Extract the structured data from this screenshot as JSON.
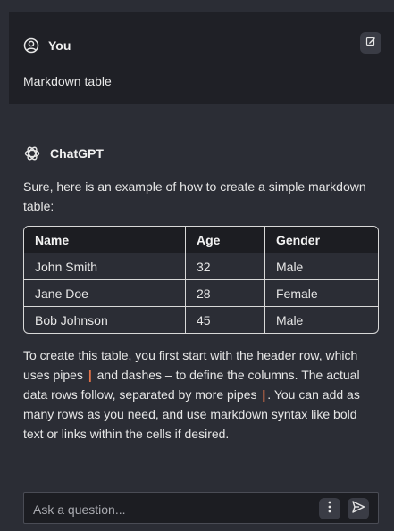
{
  "user_message": {
    "author": "You",
    "text": "Markdown table",
    "avatar_icon": "user-circle-icon",
    "edit_icon": "edit-icon"
  },
  "assistant_message": {
    "author": "ChatGPT",
    "avatar_icon": "openai-logo-icon",
    "intro": "Sure, here is an example of how to create a simple markdown table:",
    "table": {
      "headers": [
        "Name",
        "Age",
        "Gender"
      ],
      "rows": [
        [
          "John Smith",
          "32",
          "Male"
        ],
        [
          "Jane Doe",
          "28",
          "Female"
        ],
        [
          "Bob Johnson",
          "45",
          "Male"
        ]
      ]
    },
    "body": {
      "part1": "To create this table, you first start with the header row, which uses pipes",
      "pipe": "|",
      "part2": "and dashes – to define the columns. The actual data rows follow, separated by more pipes",
      "part3": ". You can add as many rows as you need, and use markdown syntax like bold text or links within the cells if desired."
    }
  },
  "input": {
    "placeholder": "Ask a question...",
    "value": "",
    "menu_icon": "vertical-dots-icon",
    "send_icon": "send-icon"
  },
  "colors": {
    "background": "#2b2d35",
    "user_panel": "#1f2026",
    "pipe_accent": "#e2734a"
  }
}
